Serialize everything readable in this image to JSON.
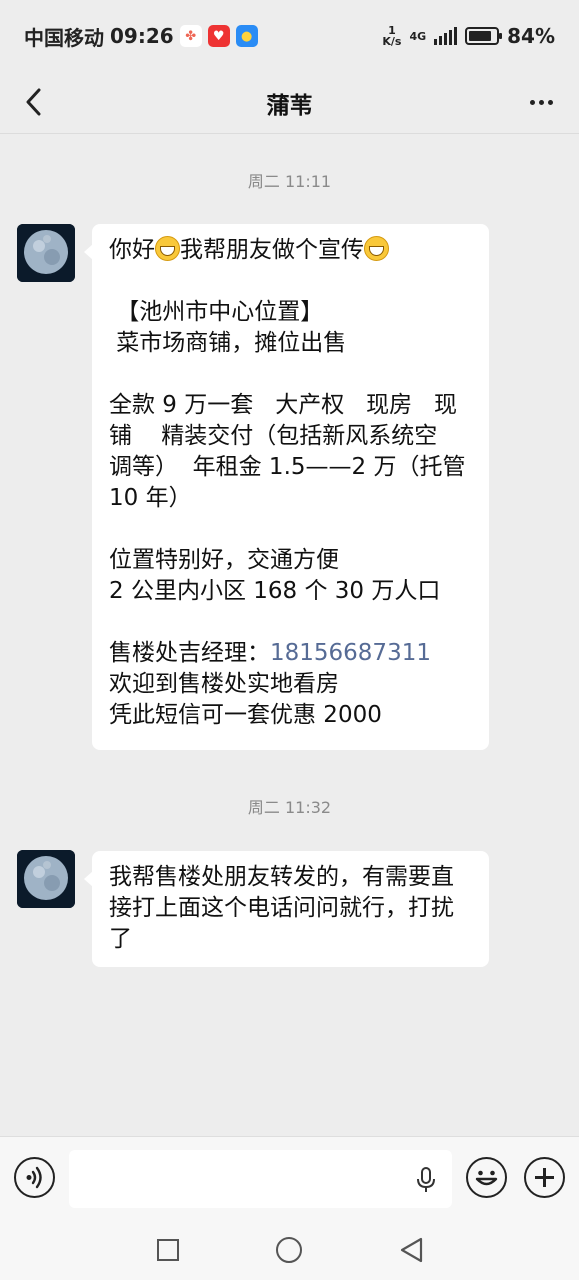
{
  "status_bar": {
    "carrier": "中国移动",
    "time": "09:26",
    "net_speed": "1",
    "net_speed_unit": "K/s",
    "network_type": "4G",
    "battery": "84%",
    "battery_level": 0.84
  },
  "header": {
    "title": "蒲苇"
  },
  "messages": [
    {
      "timestamp": "周二 11:11",
      "lines": [
        {
          "before": "你好",
          "middle": "我帮朋友做个宣传",
          "after": ""
        },
        "",
        " 【池州市中心位置】",
        " 菜市场商铺，摊位出售",
        "",
        "全款 9 万一套   大产权   现房   现",
        "铺    精装交付（包括新风系统空",
        "调等）  年租金 1.5——2 万（托管",
        "10 年）",
        "",
        "位置特别好，交通方便",
        "2 公里内小区 168 个 30 万人口",
        "",
        {
          "label": "售楼处吉经理：",
          "phone": "18156687311"
        },
        "欢迎到售楼处实地看房",
        "凭此短信可一套优惠 2000"
      ]
    },
    {
      "timestamp": "周二 11:32",
      "lines": [
        "我帮售楼处朋友转发的，有需要直",
        "接打上面这个电话问问就行，打扰",
        "了"
      ]
    }
  ],
  "input": {
    "value": "",
    "placeholder": ""
  },
  "icons": {
    "back": "chevron-left-icon",
    "more": "more-dots-icon",
    "voice": "voice-icon",
    "mic": "microphone-icon",
    "emoji": "emoji-icon",
    "plus": "plus-icon"
  }
}
